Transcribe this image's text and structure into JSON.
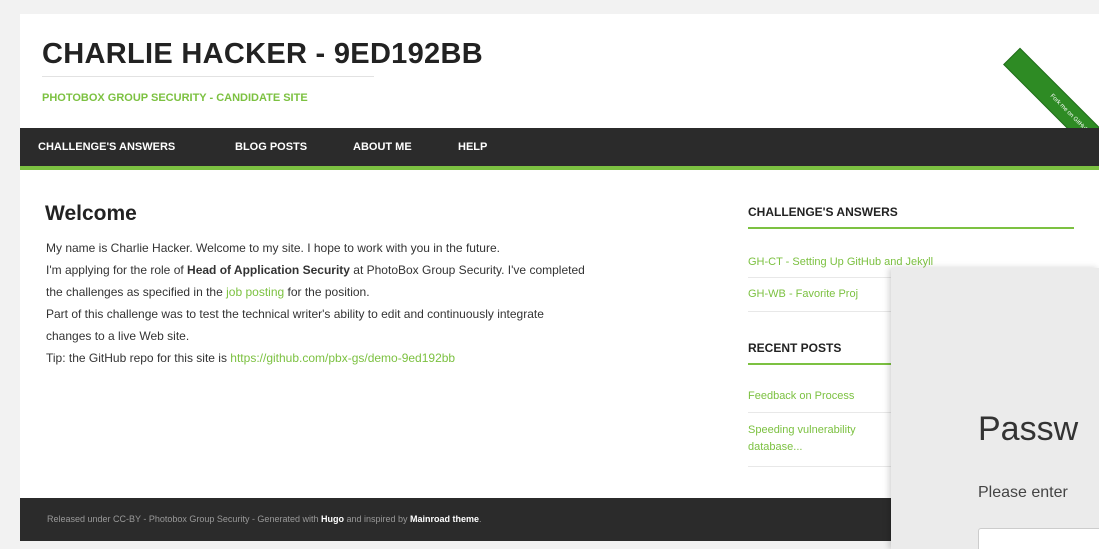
{
  "site": {
    "title": "CHARLIE HACKER - 9ED192BB",
    "tagline": "PHOTOBOX GROUP SECURITY - CANDIDATE SITE",
    "ribbon": "Fork me on GitHub"
  },
  "nav": {
    "items": [
      {
        "label": "CHALLENGE'S ANSWERS"
      },
      {
        "label": "BLOG POSTS"
      },
      {
        "label": "ABOUT ME"
      },
      {
        "label": "HELP"
      }
    ]
  },
  "main": {
    "heading": "Welcome",
    "line1": "My name is Charlie Hacker. Welcome to my site. I hope to work with you in the future.",
    "line2_pre": "I'm applying for the role of ",
    "line2_bold": "Head of Application Security",
    "line2_post": " at PhotoBox Group Security. I've completed",
    "line3_pre": "the challenges as specified in the ",
    "line3_link": "job posting",
    "line3_post": " for the position.",
    "line4": "Part of this challenge was to test the technical writer's ability to edit and continuously integrate",
    "line5": "changes to a live Web site.",
    "line6_pre": "Tip: the GitHub repo for this site is ",
    "line6_link": "https://github.com/pbx-gs/demo-9ed192bb"
  },
  "sidebar": {
    "answers_heading": "CHALLENGE'S ANSWERS",
    "answers": [
      {
        "label": "GH-CT - Setting Up GitHub and Jekyll"
      },
      {
        "label": "GH-WB - Favorite Proj"
      }
    ],
    "recent_heading": "RECENT POSTS",
    "posts": [
      {
        "label": "Feedback on Process"
      },
      {
        "label_line1": "Speeding vulnerability",
        "label_line2": "database..."
      }
    ]
  },
  "footer": {
    "pre": "Released under CC-BY - Photobox Group Security - Generated with ",
    "hugo": "Hugo",
    "mid": " and inspired by ",
    "theme": "Mainroad theme",
    "post": "."
  },
  "overlay": {
    "title": "Passw",
    "subtitle": "Please enter"
  }
}
